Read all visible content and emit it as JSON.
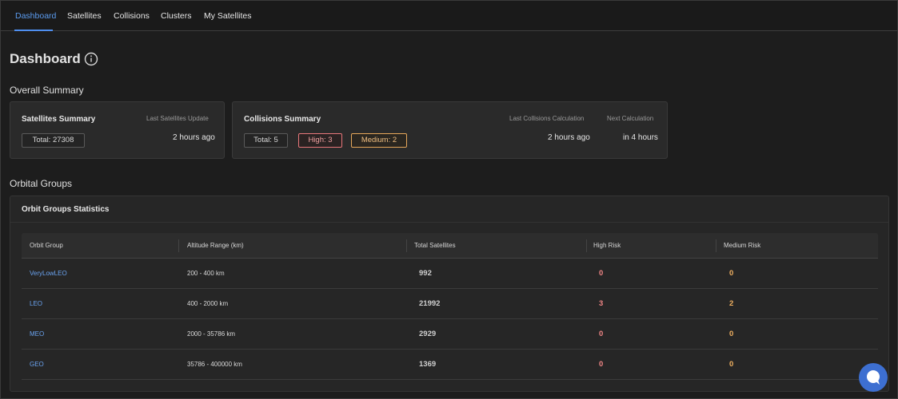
{
  "nav": {
    "tabs": [
      {
        "label": "Dashboard",
        "active": true
      },
      {
        "label": "Satellites"
      },
      {
        "label": "Collisions"
      },
      {
        "label": "Clusters"
      },
      {
        "label": "My Satellites"
      }
    ]
  },
  "page": {
    "title": "Dashboard",
    "info_icon": "info-circle-icon"
  },
  "overall_summary": {
    "heading": "Overall Summary",
    "satellites": {
      "title": "Satellites Summary",
      "total_label": "Total: 27308",
      "last_update_label": "Last Satellites Update",
      "last_update_value": "2 hours ago"
    },
    "collisions": {
      "title": "Collisions Summary",
      "total_label": "Total: 5",
      "high_label": "High: 3",
      "medium_label": "Medium: 2",
      "last_calc_label": "Last Collisions Calculation",
      "last_calc_value": "2 hours ago",
      "next_calc_label": "Next Calculation",
      "next_calc_value": "in 4 hours"
    }
  },
  "orbital_groups": {
    "heading": "Orbital Groups",
    "panel_title": "Orbit Groups Statistics",
    "columns": [
      "Orbit Group",
      "Altitude Range (km)",
      "Total Satellites",
      "High Risk",
      "Medium Risk"
    ],
    "rows": [
      {
        "group": "VeryLowLEO",
        "altitude": "200 - 400 km",
        "total": "992",
        "high": "0",
        "medium": "0"
      },
      {
        "group": "LEO",
        "altitude": "400 - 2000 km",
        "total": "21992",
        "high": "3",
        "medium": "2"
      },
      {
        "group": "MEO",
        "altitude": "2000 - 35786 km",
        "total": "2929",
        "high": "0",
        "medium": "0"
      },
      {
        "group": "GEO",
        "altitude": "35786 - 400000 km",
        "total": "1369",
        "high": "0",
        "medium": "0"
      }
    ]
  },
  "colors": {
    "accent": "#5b9cf0",
    "high": "#f08585",
    "medium": "#f0b060",
    "chat": "#3d6fd1"
  },
  "chat": {
    "icon": "chat-bubble-icon"
  }
}
